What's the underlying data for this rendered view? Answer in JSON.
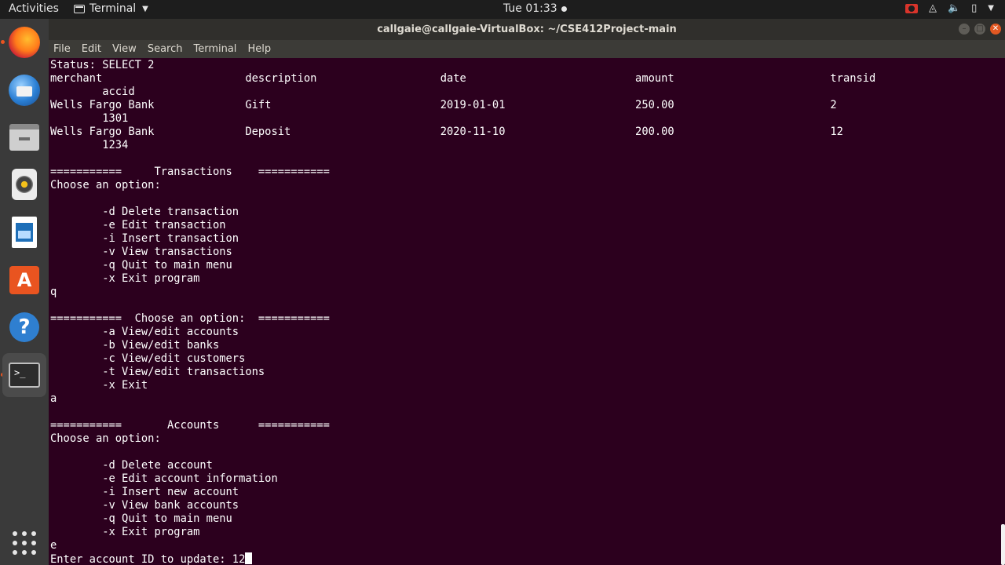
{
  "topbar": {
    "activities": "Activities",
    "app_name": "Terminal",
    "clock": "Tue 01:33"
  },
  "dock": {
    "items": [
      "firefox-icon",
      "thunderbird-icon",
      "files-icon",
      "rhythmbox-icon",
      "libreoffice-writer-icon",
      "ubuntu-software-icon",
      "help-icon",
      "terminal-icon"
    ],
    "software_glyph": "A",
    "help_glyph": "?",
    "terminal_glyph": ">_"
  },
  "window": {
    "title": "callgaie@callgaie-VirtualBox: ~/CSE412Project-main",
    "menu": [
      "File",
      "Edit",
      "View",
      "Search",
      "Terminal",
      "Help"
    ]
  },
  "terminal": {
    "lines": [
      "Status: SELECT 2",
      "merchant                      description                   date                          amount                        transid",
      "        accid",
      "Wells Fargo Bank              Gift                          2019-01-01                    250.00                        2",
      "        1301",
      "Wells Fargo Bank              Deposit                       2020-11-10                    200.00                        12",
      "        1234",
      "",
      "===========     Transactions    ===========",
      "Choose an option:",
      "",
      "        -d Delete transaction",
      "        -e Edit transaction",
      "        -i Insert transaction",
      "        -v View transactions",
      "        -q Quit to main menu",
      "        -x Exit program",
      "q",
      "",
      "===========  Choose an option:  ===========",
      "        -a View/edit accounts",
      "        -b View/edit banks",
      "        -c View/edit customers",
      "        -t View/edit transactions",
      "        -x Exit",
      "a",
      "",
      "===========       Accounts      ===========",
      "Choose an option:",
      "",
      "        -d Delete account",
      "        -e Edit account information",
      "        -i Insert new account",
      "        -v View bank accounts",
      "        -q Quit to main menu",
      "        -x Exit program",
      "e"
    ],
    "prompt_line": "Enter account ID to update: 12"
  }
}
